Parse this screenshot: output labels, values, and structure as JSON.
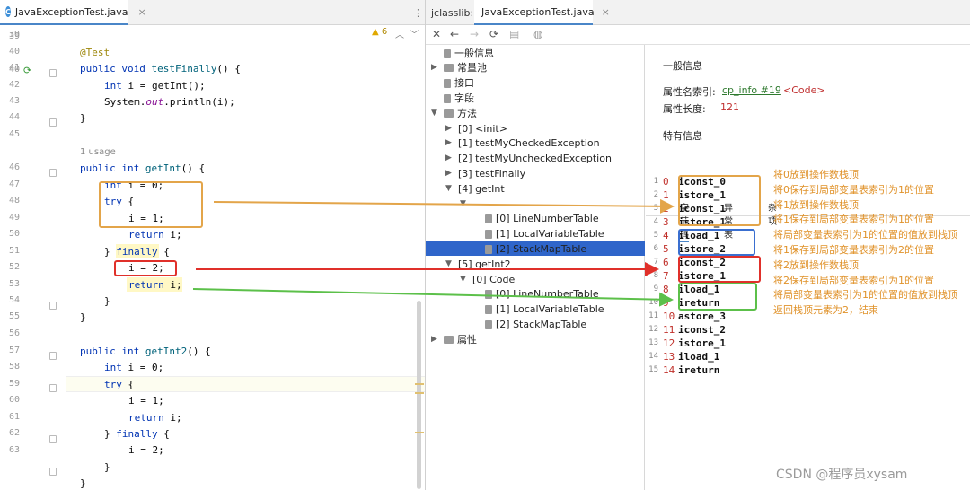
{
  "editor": {
    "tab_label": "JavaExceptionTest.java",
    "tab_close": "×",
    "more": "⋮",
    "warning_count": "6",
    "usage_hint": "1 usage",
    "line_numbers": [
      "39",
      "40",
      "41",
      "42",
      "43",
      "44",
      "45",
      "46",
      "47",
      "48",
      "49",
      "50",
      "51",
      "52",
      "53",
      "54",
      "55",
      "56",
      "57",
      "58",
      "59",
      "60",
      "61",
      "62",
      "63"
    ]
  },
  "jclasslib": {
    "title": "jclasslib:",
    "tab_label": "JavaExceptionTest.java",
    "tab_close": "×",
    "tree": {
      "general": "一般信息",
      "constant_pool": "常量池",
      "interfaces": "接口",
      "fields": "字段",
      "methods": "方法",
      "m0": "[0] <init>",
      "m1": "[1] testMyCheckedException",
      "m2": "[2] testMyUncheckedException",
      "m3": "[3] testFinally",
      "m4": "[4] getInt",
      "m4_code": "[0] Code",
      "m4_c0": "[0] LineNumberTable",
      "m4_c1": "[1] LocalVariableTable",
      "m4_c2": "[2] StackMapTable",
      "m5": "[5] getInt2",
      "m5_code": "[0] Code",
      "m5_c0": "[0] LineNumberTable",
      "m5_c1": "[1] LocalVariableTable",
      "m5_c2": "[2] StackMapTable",
      "attributes": "属性"
    },
    "detail": {
      "general_title": "一般信息",
      "name_index_label": "属性名索引:",
      "name_index_link": "cp_info #19",
      "name_index_value": "<Code>",
      "length_label": "属性长度:",
      "length_value": "121",
      "specific_title": "特有信息",
      "tabs": [
        "字节码",
        "异常表",
        "杂项"
      ]
    },
    "bytecode": [
      {
        "ln": "1",
        "off": "0",
        "op": "iconst_0"
      },
      {
        "ln": "2",
        "off": "1",
        "op": "istore_1"
      },
      {
        "ln": "3",
        "off": "2",
        "op": "iconst_1"
      },
      {
        "ln": "4",
        "off": "3",
        "op": "istore_1"
      },
      {
        "ln": "5",
        "off": "4",
        "op": "iload_1"
      },
      {
        "ln": "6",
        "off": "5",
        "op": "istore_2"
      },
      {
        "ln": "7",
        "off": "6",
        "op": "iconst_2"
      },
      {
        "ln": "8",
        "off": "7",
        "op": "istore_1"
      },
      {
        "ln": "9",
        "off": "8",
        "op": "iload_1"
      },
      {
        "ln": "10",
        "off": "9",
        "op": "ireturn"
      },
      {
        "ln": "11",
        "off": "10",
        "op": "astore_3"
      },
      {
        "ln": "12",
        "off": "11",
        "op": "iconst_2"
      },
      {
        "ln": "13",
        "off": "12",
        "op": "istore_1"
      },
      {
        "ln": "14",
        "off": "13",
        "op": "iload_1"
      },
      {
        "ln": "15",
        "off": "14",
        "op": "ireturn"
      }
    ],
    "notes": [
      "将0放到操作数栈顶",
      "将0保存到局部变量表索引为1的位置",
      "将1放到操作数栈顶",
      "将1保存到局部变量表索引为1的位置",
      "将局部变量表索引为1的位置的值放到栈顶",
      "将1保存到局部变量表索引为2的位置",
      "将2放到操作数栈顶",
      "将2保存到局部变量表索引为1的位置",
      "将局部变量表索引为1的位置的值放到栈顶",
      "返回栈顶元素为2，结束"
    ]
  },
  "watermark": "CSDN @程序员xysam",
  "colors": {
    "orange": "#e3a54a",
    "blue": "#3a6fd0",
    "red": "#e0302a",
    "green": "#5cc04a",
    "selection": "#2f65ca"
  }
}
